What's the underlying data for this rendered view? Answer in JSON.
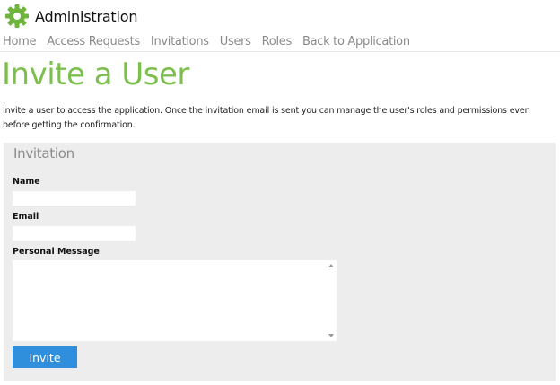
{
  "header": {
    "title": "Administration",
    "icon": "gear-icon",
    "icon_color": "#6fb43f"
  },
  "nav": {
    "items": [
      {
        "label": "Home"
      },
      {
        "label": "Access Requests"
      },
      {
        "label": "Invitations"
      },
      {
        "label": "Users"
      },
      {
        "label": "Roles"
      },
      {
        "label": "Back to Application"
      }
    ]
  },
  "page": {
    "title": "Invite a User",
    "title_color": "#7cbf4f",
    "intro": "Invite a user to access the application. Once the invitation email is sent you can manage the user's roles and permissions even before getting the confirmation."
  },
  "form": {
    "panel_title": "Invitation",
    "name_label": "Name",
    "name_value": "",
    "email_label": "Email",
    "email_value": "",
    "message_label": "Personal Message",
    "message_value": "",
    "submit_label": "Invite",
    "submit_color": "#2f8fdc"
  }
}
